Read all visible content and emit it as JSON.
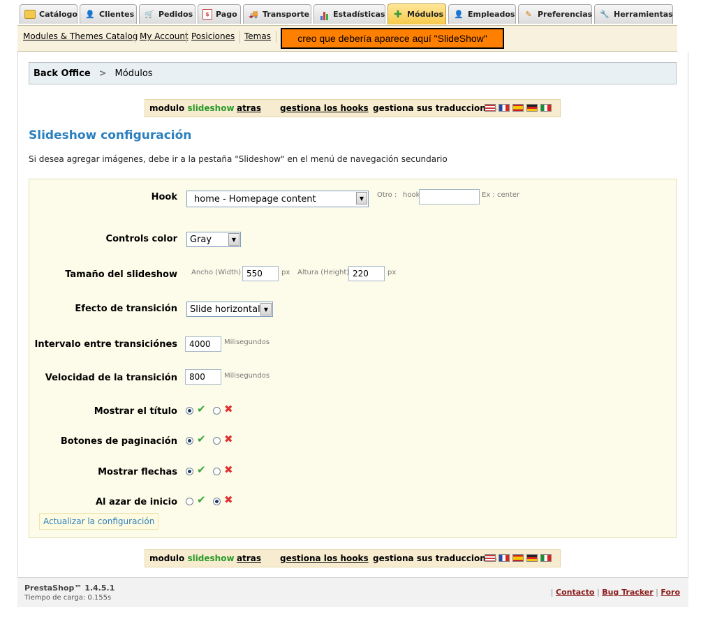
{
  "tabs": [
    {
      "label": "Catálogo",
      "icon": "folder-icon",
      "active": false
    },
    {
      "label": "Clientes",
      "icon": "user-icon",
      "active": false
    },
    {
      "label": "Pedidos",
      "icon": "cart-icon",
      "active": false
    },
    {
      "label": "Pago",
      "icon": "payment-icon",
      "active": false
    },
    {
      "label": "Transporte",
      "icon": "truck-icon",
      "active": false
    },
    {
      "label": "Estadísticas",
      "icon": "chart-icon",
      "active": false
    },
    {
      "label": "Módulos",
      "icon": "puzzle-icon",
      "active": true
    },
    {
      "label": "Empleados",
      "icon": "employee-icon",
      "active": false
    },
    {
      "label": "Preferencias",
      "icon": "preferences-icon",
      "active": false
    },
    {
      "label": "Herramientas",
      "icon": "wrench-icon",
      "active": false
    }
  ],
  "subnav": {
    "links": [
      "Modules & Themes Catalog",
      "My Account",
      "Posiciones",
      "Temas"
    ],
    "note": "creo que debería aparece aquí \"SlideShow\""
  },
  "breadcrumb": {
    "root": "Back Office",
    "current": "Módulos"
  },
  "toolbar": {
    "module_prefix": "modulo",
    "module_name": "slideshow",
    "back": "atras",
    "hooks": "gestiona los hooks",
    "translations": "gestiona sus traducciones",
    "flags": [
      "us",
      "fr",
      "es",
      "de",
      "it"
    ]
  },
  "page": {
    "title": "Slideshow configuración",
    "description": "Si desea agregar imágenes, debe ir a la pestaña \"Slideshow\" en el menú de navegación secundario"
  },
  "form": {
    "hook": {
      "label": "Hook",
      "value": "home - Homepage content",
      "other_label": "Otro :",
      "hook_placeholder": "hook",
      "example": "Ex : center"
    },
    "controls_color": {
      "label": "Controls color",
      "value": "Gray"
    },
    "size": {
      "label": "Tamaño del slideshow",
      "width_label": "Ancho (Width)",
      "width": "550",
      "height_label": "Altura (Height)",
      "height": "220",
      "unit": "px"
    },
    "transition_effect": {
      "label": "Efecto de transición",
      "value": "Slide horizontal"
    },
    "interval": {
      "label": "Intervalo entre transiciónes",
      "value": "4000",
      "unit": "Milisegundos"
    },
    "speed": {
      "label": "Velocidad de la transición",
      "value": "800",
      "unit": "Milisegundos"
    },
    "show_title": {
      "label": "Mostrar el título",
      "value": "yes"
    },
    "pagination": {
      "label": "Botones de paginación",
      "value": "yes"
    },
    "arrows": {
      "label": "Mostrar flechas",
      "value": "yes"
    },
    "random": {
      "label": "Al azar de inicio",
      "value": "no"
    },
    "submit": "Actualizar la configuración"
  },
  "footer": {
    "version": "PrestaShop™ 1.4.5.1",
    "load_time": "Tiempo de carga: 0.155s",
    "links": [
      "Contacto",
      "Bug Tracker",
      "Foro"
    ]
  }
}
